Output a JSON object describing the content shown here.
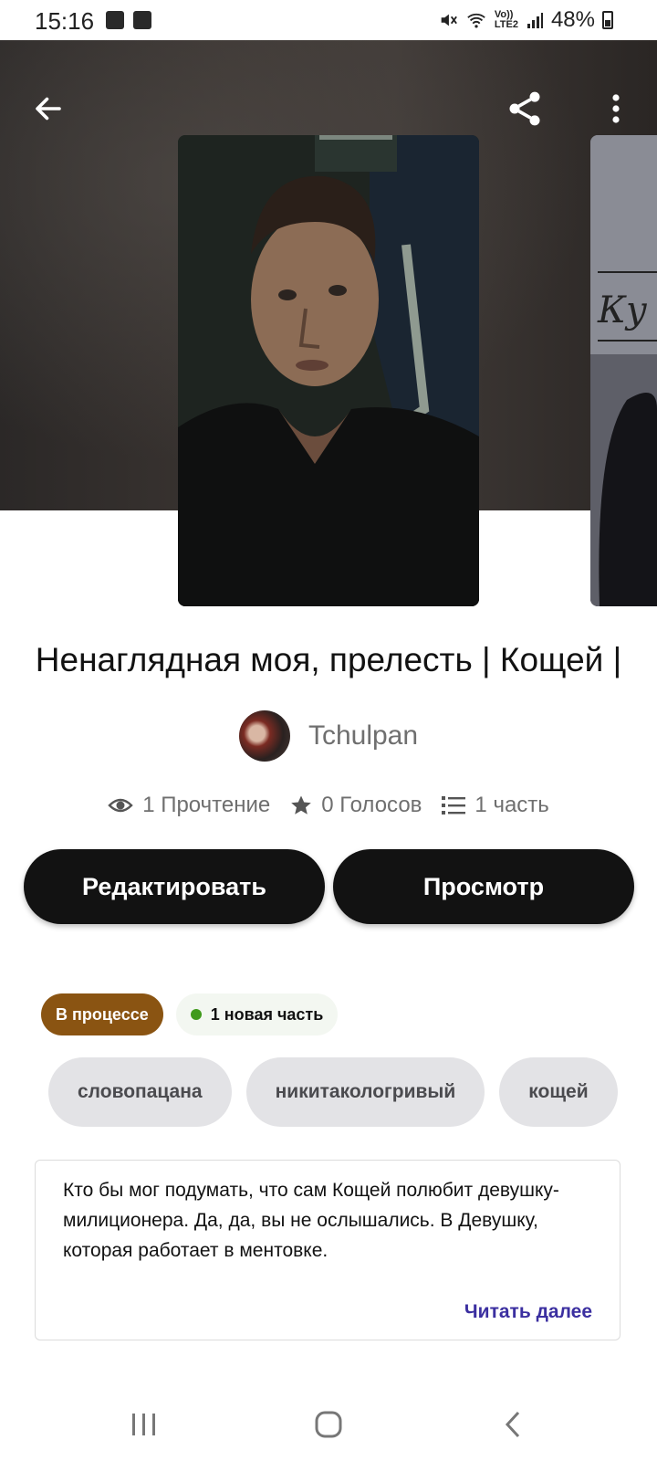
{
  "status_bar": {
    "time": "15:16",
    "network_label": "Vo))\nLTE2",
    "battery": "48%"
  },
  "story": {
    "title": "Ненаглядная моя, прелесть | Кощей |",
    "author": "Tchulpan",
    "stats": {
      "reads": "1 Прочтение",
      "votes": "0 Голосов",
      "parts": "1 часть"
    }
  },
  "buttons": {
    "edit": "Редактировать",
    "view": "Просмотр"
  },
  "badges": {
    "status": "В процессе",
    "new_part": "1 новая часть"
  },
  "tags": [
    "словопацана",
    "никитакологривый",
    "кощей"
  ],
  "description": {
    "text": "Кто бы мог подумать, что сам Кощей полюбит девушку-милиционера. Да, да, вы не ослышались. В Девушку, которая работает в ментовке.",
    "read_more": "Читать далее"
  },
  "icons": {
    "back": "arrow-left-icon",
    "share": "share-icon",
    "more": "more-vertical-icon",
    "reads": "eye-icon",
    "votes": "star-icon",
    "parts": "list-icon"
  }
}
